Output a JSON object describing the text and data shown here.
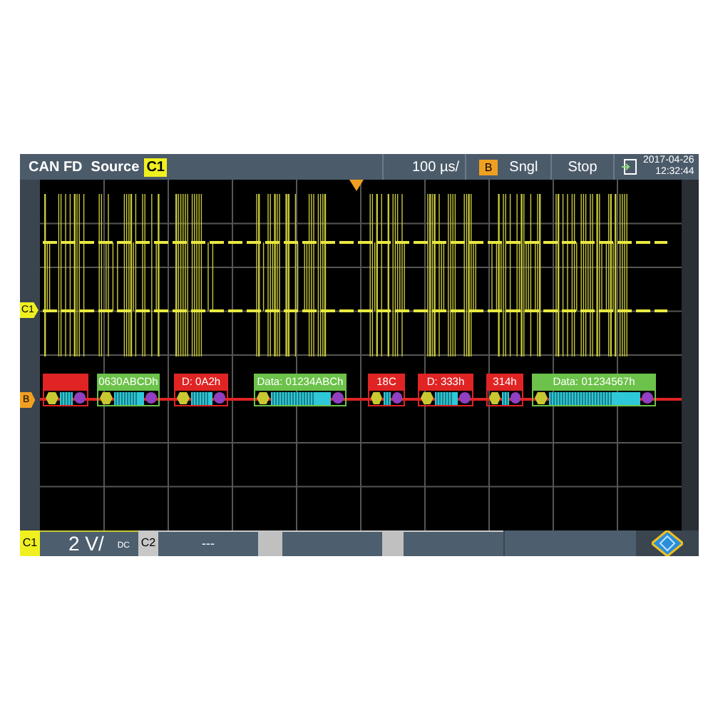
{
  "header": {
    "protocol": "CAN FD",
    "source_label": "Source",
    "source": "C1",
    "timebase": "100 µs/",
    "trigger_source": "B",
    "mode": "Sngl",
    "run_state": "Stop",
    "date": "2017-04-26",
    "time": "12:32:44"
  },
  "markers": {
    "channel": "C1",
    "bus": "B"
  },
  "frames": [
    {
      "color": "#e02424"
    },
    {
      "label": "0630ABCDh",
      "color": "#6cc24a"
    },
    {
      "label": "D: 0A2h",
      "color": "#e02424"
    },
    {
      "label": "Data: 01234ABCh",
      "color": "#6cc24a"
    },
    {
      "label": "18C",
      "color": "#e02424"
    },
    {
      "label": "D: 333h",
      "color": "#e02424"
    },
    {
      "label": "314h",
      "color": "#e02424"
    },
    {
      "label": "Data: 01234567h",
      "color": "#6cc24a"
    }
  ],
  "footer": {
    "ch1": {
      "label": "C1",
      "scale": "2 V/",
      "coupling": "DC"
    },
    "ch2": {
      "label": "C2",
      "value": "---"
    }
  }
}
